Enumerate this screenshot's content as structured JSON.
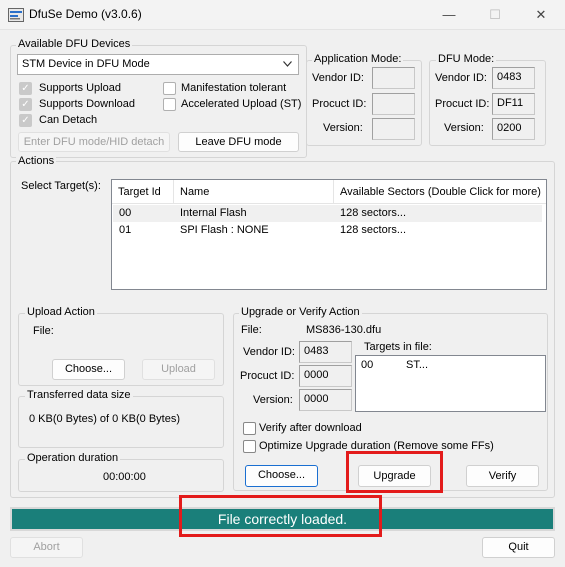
{
  "window": {
    "title": "DfuSe Demo (v3.0.6)",
    "minimize_glyph": "—",
    "maximize_glyph": "☐",
    "close_glyph": "✕"
  },
  "devices": {
    "group_title": "Available DFU Devices",
    "selected_device": "STM Device in DFU Mode",
    "supports_upload": "Supports Upload",
    "supports_download": "Supports Download",
    "can_detach": "Can Detach",
    "manifestation_tolerant": "Manifestation tolerant",
    "accelerated_upload": "Accelerated Upload (ST)",
    "enter_dfu_button": "Enter DFU mode/HID detach",
    "leave_dfu_button": "Leave DFU mode"
  },
  "app_mode": {
    "group_title": "Application Mode:",
    "vendor_id_label": "Vendor ID:",
    "product_id_label": "Procuct ID:",
    "version_label": "Version:",
    "vendor_id": "",
    "product_id": "",
    "version": ""
  },
  "dfu_mode": {
    "group_title": "DFU Mode:",
    "vendor_id_label": "Vendor ID:",
    "product_id_label": "Procuct ID:",
    "version_label": "Version:",
    "vendor_id": "0483",
    "product_id": "DF11",
    "version": "0200"
  },
  "actions": {
    "group_title": "Actions",
    "select_targets_label": "Select Target(s):",
    "columns": [
      "Target Id",
      "Name",
      "Available Sectors (Double Click for more)"
    ],
    "targets": [
      {
        "id": "00",
        "name": "Internal Flash",
        "sectors": "128 sectors..."
      },
      {
        "id": "01",
        "name": "SPI Flash : NONE",
        "sectors": "128 sectors..."
      }
    ]
  },
  "upload": {
    "group_title": "Upload Action",
    "file_label": "File:",
    "choose_button": "Choose...",
    "upload_button": "Upload"
  },
  "transfer": {
    "group_title": "Transferred data size",
    "value": "0 KB(0 Bytes) of 0 KB(0 Bytes)"
  },
  "duration": {
    "group_title": "Operation duration",
    "value": "00:00:00"
  },
  "upgrade": {
    "group_title": "Upgrade or Verify Action",
    "file_label": "File:",
    "file_name": "MS836-130.dfu",
    "vendor_id_label": "Vendor ID:",
    "product_id_label": "Procuct ID:",
    "version_label": "Version:",
    "vendor_id": "0483",
    "product_id": "0000",
    "version": "0000",
    "targets_in_file_label": "Targets in file:",
    "targets_in_file": [
      {
        "id": "00",
        "name": "ST..."
      }
    ],
    "verify_after_download": "Verify after download",
    "optimize_upgrade": "Optimize Upgrade duration (Remove some FFs)",
    "choose_button": "Choose...",
    "upgrade_button": "Upgrade",
    "verify_button": "Verify"
  },
  "status": {
    "message": "File correctly loaded.",
    "bar_color": "#1a7f7a",
    "highlight_color": "#e31b1b"
  },
  "footer": {
    "abort_button": "Abort",
    "quit_button": "Quit"
  }
}
